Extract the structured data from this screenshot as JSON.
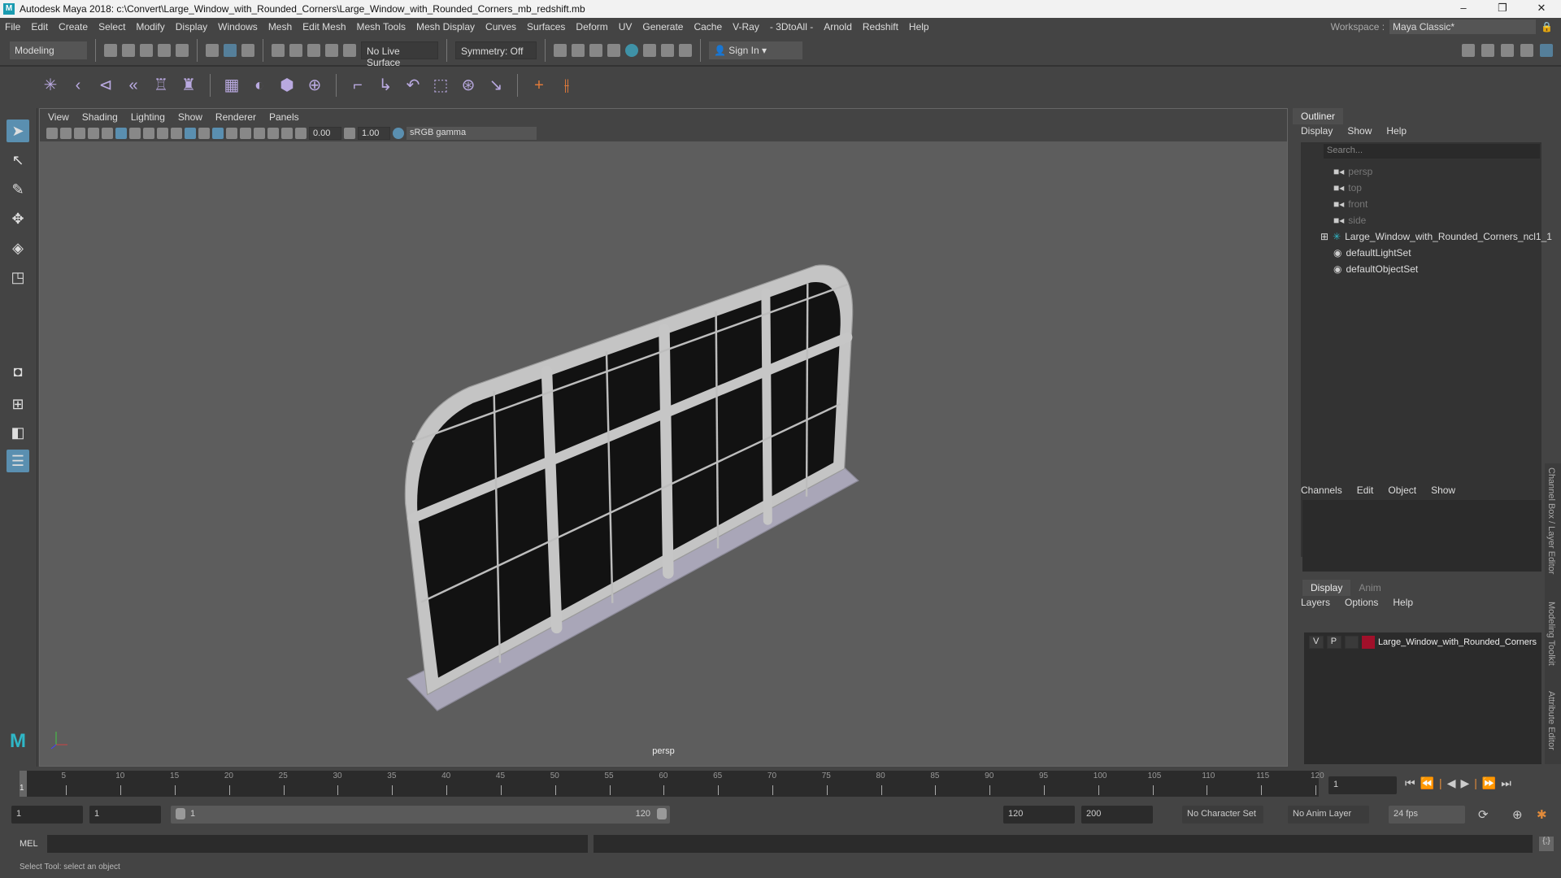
{
  "title": "Autodesk Maya 2018: c:\\Convert\\Large_Window_with_Rounded_Corners\\Large_Window_with_Rounded_Corners_mb_redshift.mb",
  "menu": [
    "File",
    "Edit",
    "Create",
    "Select",
    "Modify",
    "Display",
    "Windows",
    "Mesh",
    "Edit Mesh",
    "Mesh Tools",
    "Mesh Display",
    "Curves",
    "Surfaces",
    "Deform",
    "UV",
    "Generate",
    "Cache",
    "V-Ray",
    "- 3DtoAll -",
    "Arnold",
    "Redshift",
    "Help"
  ],
  "workspace": {
    "label": "Workspace :",
    "value": "Maya Classic*"
  },
  "status": {
    "mode": "Modeling",
    "live_surface": "No Live Surface",
    "symmetry": "Symmetry: Off",
    "sign_in": "Sign In"
  },
  "viewport": {
    "menu": [
      "View",
      "Shading",
      "Lighting",
      "Show",
      "Renderer",
      "Panels"
    ],
    "exposure": "0.00",
    "gamma": "1.00",
    "color_space": "sRGB gamma",
    "camera": "persp"
  },
  "outliner": {
    "tab": "Outliner",
    "menu": [
      "Display",
      "Show",
      "Help"
    ],
    "search_placeholder": "Search...",
    "items": [
      {
        "label": "persp",
        "icon": "camera-icon",
        "dim": true
      },
      {
        "label": "top",
        "icon": "camera-icon",
        "dim": true
      },
      {
        "label": "front",
        "icon": "camera-icon",
        "dim": true
      },
      {
        "label": "side",
        "icon": "camera-icon",
        "dim": true
      },
      {
        "label": "Large_Window_with_Rounded_Corners_ncl1_1",
        "icon": "transform-icon",
        "dim": false
      },
      {
        "label": "defaultLightSet",
        "icon": "set-icon",
        "dim": false
      },
      {
        "label": "defaultObjectSet",
        "icon": "set-icon",
        "dim": false
      }
    ]
  },
  "channel_box": {
    "menu": [
      "Channels",
      "Edit",
      "Object",
      "Show"
    ]
  },
  "layer_editor": {
    "tabs": [
      "Display",
      "Anim"
    ],
    "menu": [
      "Layers",
      "Options",
      "Help"
    ],
    "layer": {
      "v": "V",
      "p": "P",
      "name": "Large_Window_with_Rounded_Corners",
      "color": "#a0102a"
    }
  },
  "side_tabs": [
    "Channel Box / Layer Editor",
    "Modeling Toolkit",
    "Attribute Editor"
  ],
  "timeline": {
    "start": 1,
    "end": 120,
    "step": 5,
    "current_frame": "1",
    "current_label": "1"
  },
  "range": {
    "start": "1",
    "anim_start": "1",
    "slider_start": "1",
    "slider_end": "120",
    "end": "120",
    "anim_end": "200",
    "character_set": "No Character Set",
    "anim_layer": "No Anim Layer",
    "fps": "24 fps"
  },
  "mel": {
    "label": "MEL"
  },
  "help_line": "Select Tool: select an object"
}
